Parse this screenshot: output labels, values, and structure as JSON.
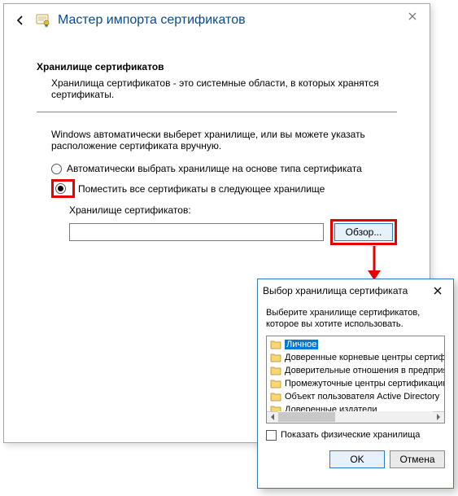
{
  "wizard": {
    "title": "Мастер импорта сертификатов",
    "section_title": "Хранилище сертификатов",
    "section_desc": "Хранилища сертификатов - это системные области, в которых хранятся сертификаты.",
    "lead": "Windows автоматически выберет хранилище, или вы можете указать расположение сертификата вручную.",
    "radio_auto": "Автоматически выбрать хранилище на основе типа сертификата",
    "radio_place": "Поместить все сертификаты в следующее хранилище",
    "store_label": "Хранилище сертификатов:",
    "store_value": "",
    "browse": "Обзор..."
  },
  "dialog": {
    "title": "Выбор хранилища сертификата",
    "lead": "Выберите хранилище сертификатов, которое вы хотите использовать.",
    "items": [
      "Личное",
      "Доверенные корневые центры сертифика",
      "Доверительные отношения в предприяти",
      "Промежуточные центры сертификации",
      "Объект пользователя Active Directory",
      "Доверенные издатели"
    ],
    "show_physical": "Показать физические хранилища",
    "ok": "OK",
    "cancel": "Отмена"
  }
}
